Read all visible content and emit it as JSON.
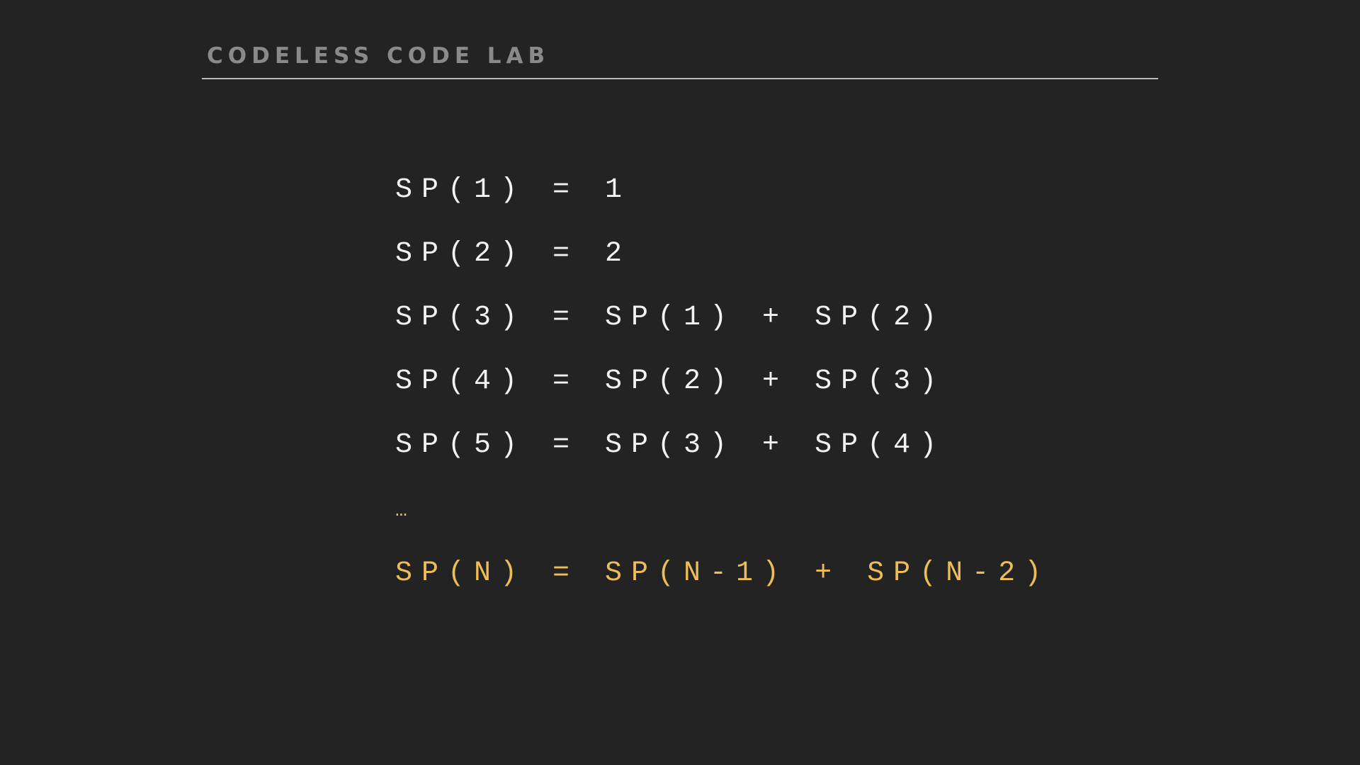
{
  "header": {
    "brand": "CODELESS CODE LAB"
  },
  "formulas": [
    "SP(1) = 1",
    "SP(2) = 2",
    "SP(3) = SP(1) + SP(2)",
    "SP(4) = SP(2) + SP(3)",
    "SP(5) = SP(3) + SP(4)"
  ],
  "ellipsis": "…",
  "general_formula": "SP(N) = SP(N-1) + SP(N-2)",
  "colors": {
    "background": "#232323",
    "text": "#f2f2f2",
    "accent": "#eebd57",
    "brand": "#8a8a8a",
    "rule": "#b9b9b9"
  }
}
